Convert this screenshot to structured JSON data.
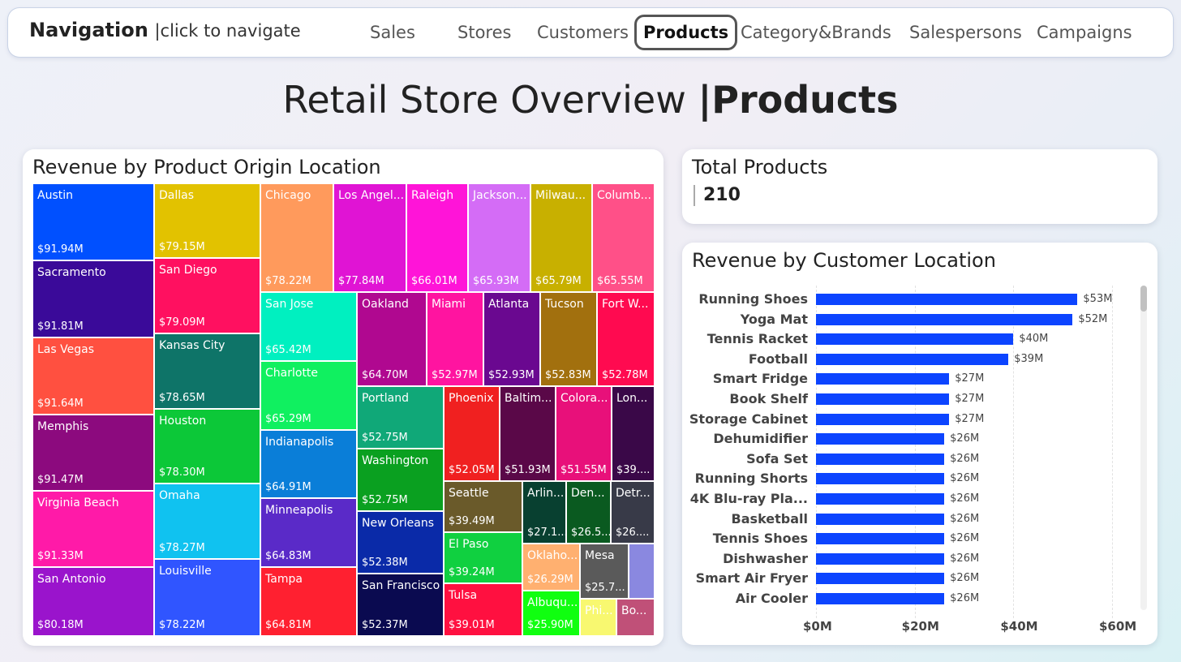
{
  "nav": {
    "title": "Navigation",
    "subtitle": "|click to navigate",
    "items": [
      "Sales",
      "Stores",
      "Customers",
      "Products",
      "Category&Brands",
      "Salespersons",
      "Campaigns"
    ],
    "active": "Products"
  },
  "page": {
    "title_main": "Retail Store Overview ",
    "title_bold": "|Products"
  },
  "treemap": {
    "title": "Revenue by Product Origin Location",
    "cells": [
      {
        "name": "Austin",
        "value": "$91.94M",
        "color": "#0050ff"
      },
      {
        "name": "Sacramento",
        "value": "$91.81M",
        "color": "#3a0a99"
      },
      {
        "name": "Las Vegas",
        "value": "$91.64M",
        "color": "#ff5040"
      },
      {
        "name": "Memphis",
        "value": "$91.47M",
        "color": "#8c0a7e"
      },
      {
        "name": "Virginia Beach",
        "value": "$91.33M",
        "color": "#ff1aa8"
      },
      {
        "name": "San Antonio",
        "value": "$80.18M",
        "color": "#9a14cc"
      },
      {
        "name": "Dallas",
        "value": "$79.15M",
        "color": "#e2c200"
      },
      {
        "name": "San Diego",
        "value": "$79.09M",
        "color": "#ff1060"
      },
      {
        "name": "Kansas City",
        "value": "$78.65M",
        "color": "#0e7468"
      },
      {
        "name": "Houston",
        "value": "$78.30M",
        "color": "#0cc838"
      },
      {
        "name": "Omaha",
        "value": "$78.27M",
        "color": "#10c2f0"
      },
      {
        "name": "Louisville",
        "value": "$78.22M",
        "color": "#3055ff"
      },
      {
        "name": "Chicago",
        "value": "$78.22M",
        "color": "#ff9a5c"
      },
      {
        "name": "Los Angel...",
        "value": "$77.84M",
        "color": "#e014d4"
      },
      {
        "name": "Raleigh",
        "value": "$66.01M",
        "color": "#ff14d8"
      },
      {
        "name": "Jackson...",
        "value": "$65.93M",
        "color": "#d46cf6"
      },
      {
        "name": "Milwau...",
        "value": "$65.79M",
        "color": "#c8b000"
      },
      {
        "name": "Columb...",
        "value": "$65.55M",
        "color": "#ff5088"
      },
      {
        "name": "San Jose",
        "value": "$65.42M",
        "color": "#00f0c0"
      },
      {
        "name": "Charlotte",
        "value": "$65.29M",
        "color": "#10f060"
      },
      {
        "name": "Indianapolis",
        "value": "$64.91M",
        "color": "#0a7ed8"
      },
      {
        "name": "Minneapolis",
        "value": "$64.83M",
        "color": "#5a2ac8"
      },
      {
        "name": "Tampa",
        "value": "$64.81M",
        "color": "#ff2030"
      },
      {
        "name": "Oakland",
        "value": "$64.70M",
        "color": "#b00890"
      },
      {
        "name": "Miami",
        "value": "$52.97M",
        "color": "#ff14a0"
      },
      {
        "name": "Atlanta",
        "value": "$52.93M",
        "color": "#6a0890"
      },
      {
        "name": "Tucson",
        "value": "$52.83M",
        "color": "#a2700e"
      },
      {
        "name": "Fort W...",
        "value": "$52.78M",
        "color": "#ff0a50"
      },
      {
        "name": "Portland",
        "value": "$52.75M",
        "color": "#10a878"
      },
      {
        "name": "Washington",
        "value": "$52.75M",
        "color": "#0aa020"
      },
      {
        "name": "New Orleans",
        "value": "$52.38M",
        "color": "#0a2aa8"
      },
      {
        "name": "San Francisco",
        "value": "$52.37M",
        "color": "#0a0a50"
      },
      {
        "name": "Phoenix",
        "value": "$52.05M",
        "color": "#f02020"
      },
      {
        "name": "Baltim...",
        "value": "$51.93M",
        "color": "#5a0848"
      },
      {
        "name": "Colora...",
        "value": "$51.55M",
        "color": "#e8107a"
      },
      {
        "name": "Lon...",
        "value": "$39....",
        "color": "#3a0848"
      },
      {
        "name": "Seattle",
        "value": "$39.49M",
        "color": "#6a5a2a"
      },
      {
        "name": "Arlin...",
        "value": "$27.1...",
        "color": "#084030"
      },
      {
        "name": "Den...",
        "value": "$26.5...",
        "color": "#0a5a20"
      },
      {
        "name": "Detr...",
        "value": "$26....",
        "color": "#383a48"
      },
      {
        "name": "El Paso",
        "value": "$39.24M",
        "color": "#10d040"
      },
      {
        "name": "Tulsa",
        "value": "$39.01M",
        "color": "#ff1040"
      },
      {
        "name": "Oklaho...",
        "value": "$26.29M",
        "color": "#ffb070"
      },
      {
        "name": "Albuqu...",
        "value": "$25.90M",
        "color": "#10ff10"
      },
      {
        "name": "Mesa",
        "value": "$25.7...",
        "color": "#5a5a5a"
      },
      {
        "name": "",
        "value": "",
        "color": "#8a88e0"
      },
      {
        "name": "Phi...",
        "value": "",
        "color": "#f8f870"
      },
      {
        "name": "Bo...",
        "value": "",
        "color": "#c05078"
      }
    ]
  },
  "kpi": {
    "title": "Total Products",
    "value": "210"
  },
  "bar_chart": {
    "title": "Revenue by Customer Location",
    "x_ticks": [
      "$0M",
      "$20M",
      "$40M",
      "$60M"
    ]
  },
  "chart_data": {
    "type": "bar",
    "orientation": "horizontal",
    "title": "Revenue by Customer Location",
    "categories": [
      "Running Shoes",
      "Yoga Mat",
      "Tennis Racket",
      "Football",
      "Smart Fridge",
      "Book Shelf",
      "Storage Cabinet",
      "Dehumidifier",
      "Sofa Set",
      "Running Shorts",
      "4K Blu-ray Pla...",
      "Basketball",
      "Tennis Shoes",
      "Dishwasher",
      "Smart Air Fryer",
      "Air Cooler"
    ],
    "values": [
      53,
      52,
      40,
      39,
      27,
      27,
      27,
      26,
      26,
      26,
      26,
      26,
      26,
      26,
      26,
      26
    ],
    "labels": [
      "$53M",
      "$52M",
      "$40M",
      "$39M",
      "$27M",
      "$27M",
      "$27M",
      "$26M",
      "$26M",
      "$26M",
      "$26M",
      "$26M",
      "$26M",
      "$26M",
      "$26M",
      "$26M"
    ],
    "xlim": [
      0,
      60
    ],
    "x_ticks": [
      "$0M",
      "$20M",
      "$40M",
      "$60M"
    ],
    "color": "#0c44ff",
    "grid": true
  }
}
